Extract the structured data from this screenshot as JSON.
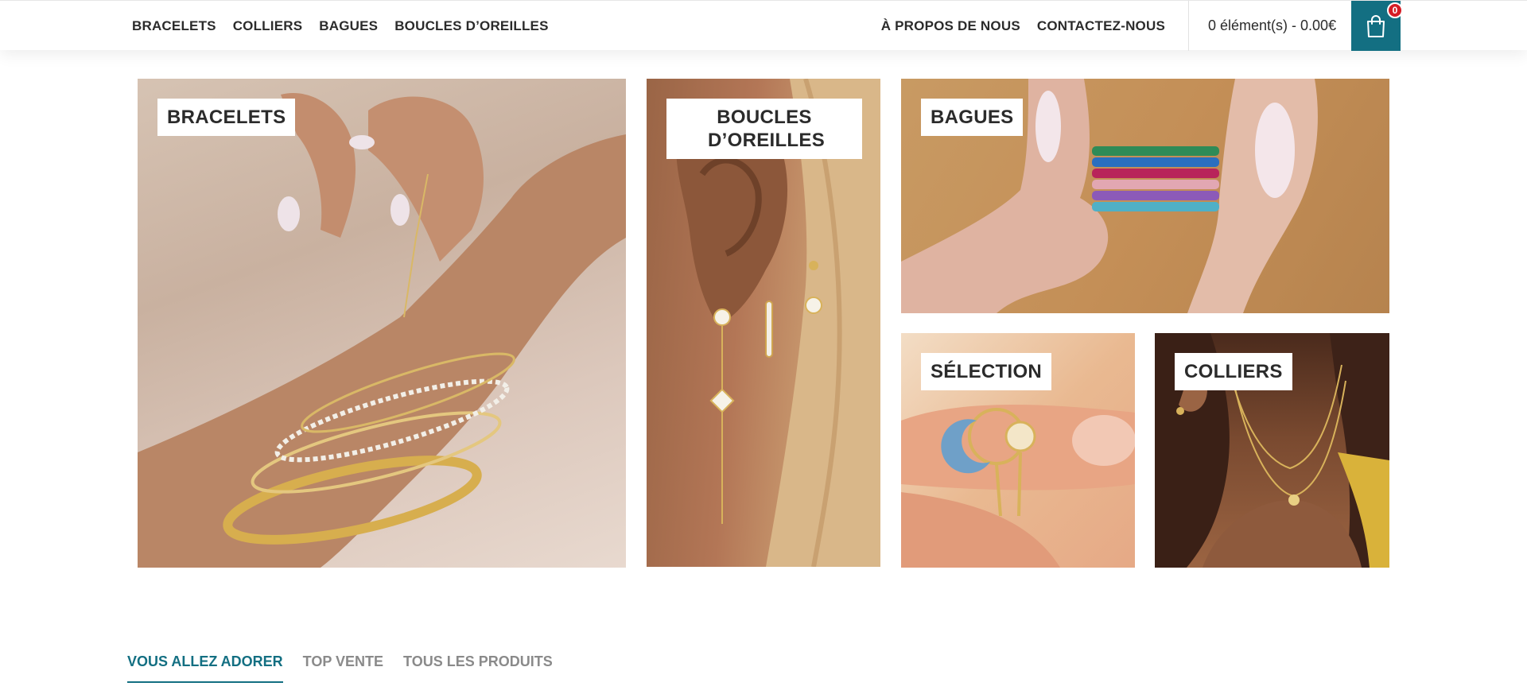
{
  "header": {
    "nav_left": [
      {
        "label": "BRACELETS"
      },
      {
        "label": "COLLIERS"
      },
      {
        "label": "BAGUES"
      },
      {
        "label": "BOUCLES D’OREILLES"
      }
    ],
    "nav_right": [
      {
        "label": "À PROPOS DE NOUS"
      },
      {
        "label": "CONTACTEZ-NOUS"
      }
    ],
    "cart": {
      "summary": "0 élément(s) - 0.00€",
      "count": "0",
      "icon": "shopping-bag-icon"
    }
  },
  "categories": {
    "bracelets": {
      "label": "BRACELETS"
    },
    "earrings": {
      "label": "BOUCLES D’OREILLES"
    },
    "rings": {
      "label": "BAGUES"
    },
    "selection": {
      "label": "SÉLECTION"
    },
    "necklaces": {
      "label": "COLLIERS"
    }
  },
  "product_tabs": [
    {
      "label": "VOUS ALLEZ ADORER",
      "active": true
    },
    {
      "label": "TOP VENTE",
      "active": false
    },
    {
      "label": "TOUS LES PRODUITS",
      "active": false
    }
  ],
  "colors": {
    "accent": "#136f82",
    "badge": "#d51c25",
    "text": "#2b2b2b",
    "inactive_tab": "#8a8a8a"
  }
}
